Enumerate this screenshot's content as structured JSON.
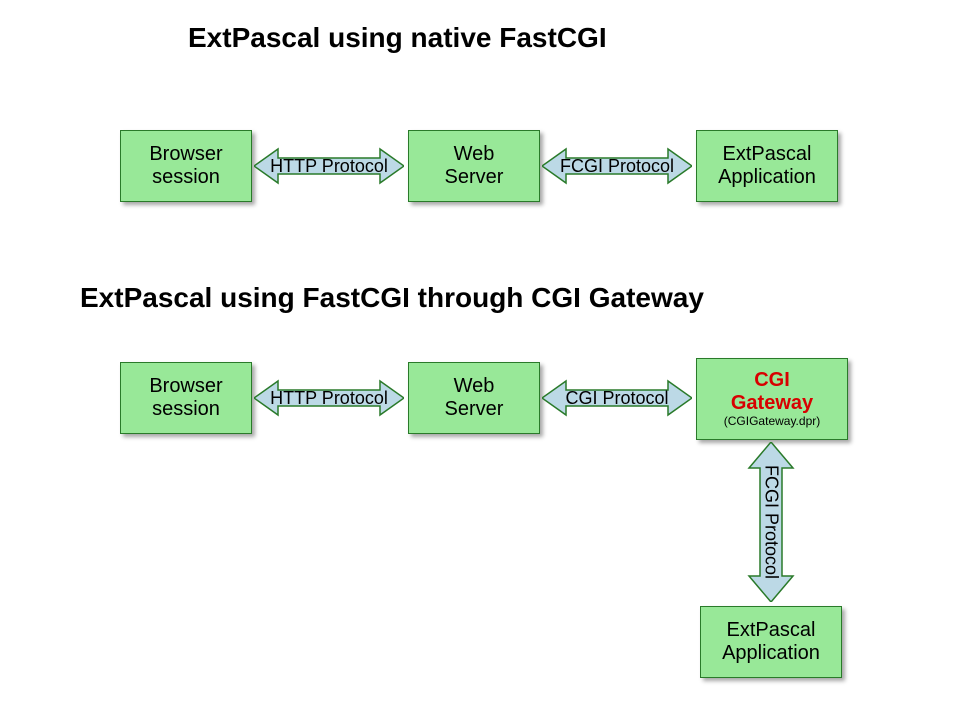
{
  "colors": {
    "box_fill": "#98e898",
    "box_border": "#2a7a2a",
    "arrow_fill": "#bcd9e6",
    "arrow_border": "#2a7a2a",
    "highlight": "#d80000"
  },
  "title1": "ExtPascal using native FastCGI",
  "title2": "ExtPascal using FastCGI through CGI Gateway",
  "row1": {
    "browser_l1": "Browser",
    "browser_l2": "session",
    "arrow1": "HTTP Protocol",
    "web_l1": "Web",
    "web_l2": "Server",
    "arrow2": "FCGI Protocol",
    "app_l1": "ExtPascal",
    "app_l2": "Application"
  },
  "row2": {
    "browser_l1": "Browser",
    "browser_l2": "session",
    "arrow1": "HTTP Protocol",
    "web_l1": "Web",
    "web_l2": "Server",
    "arrow2": "CGI Protocol",
    "gateway_l1": "CGI",
    "gateway_l2": "Gateway",
    "gateway_sub": "(CGIGateway.dpr)",
    "vlabel": "FCGI Protocol",
    "app_l1": "ExtPascal",
    "app_l2": "Application"
  }
}
